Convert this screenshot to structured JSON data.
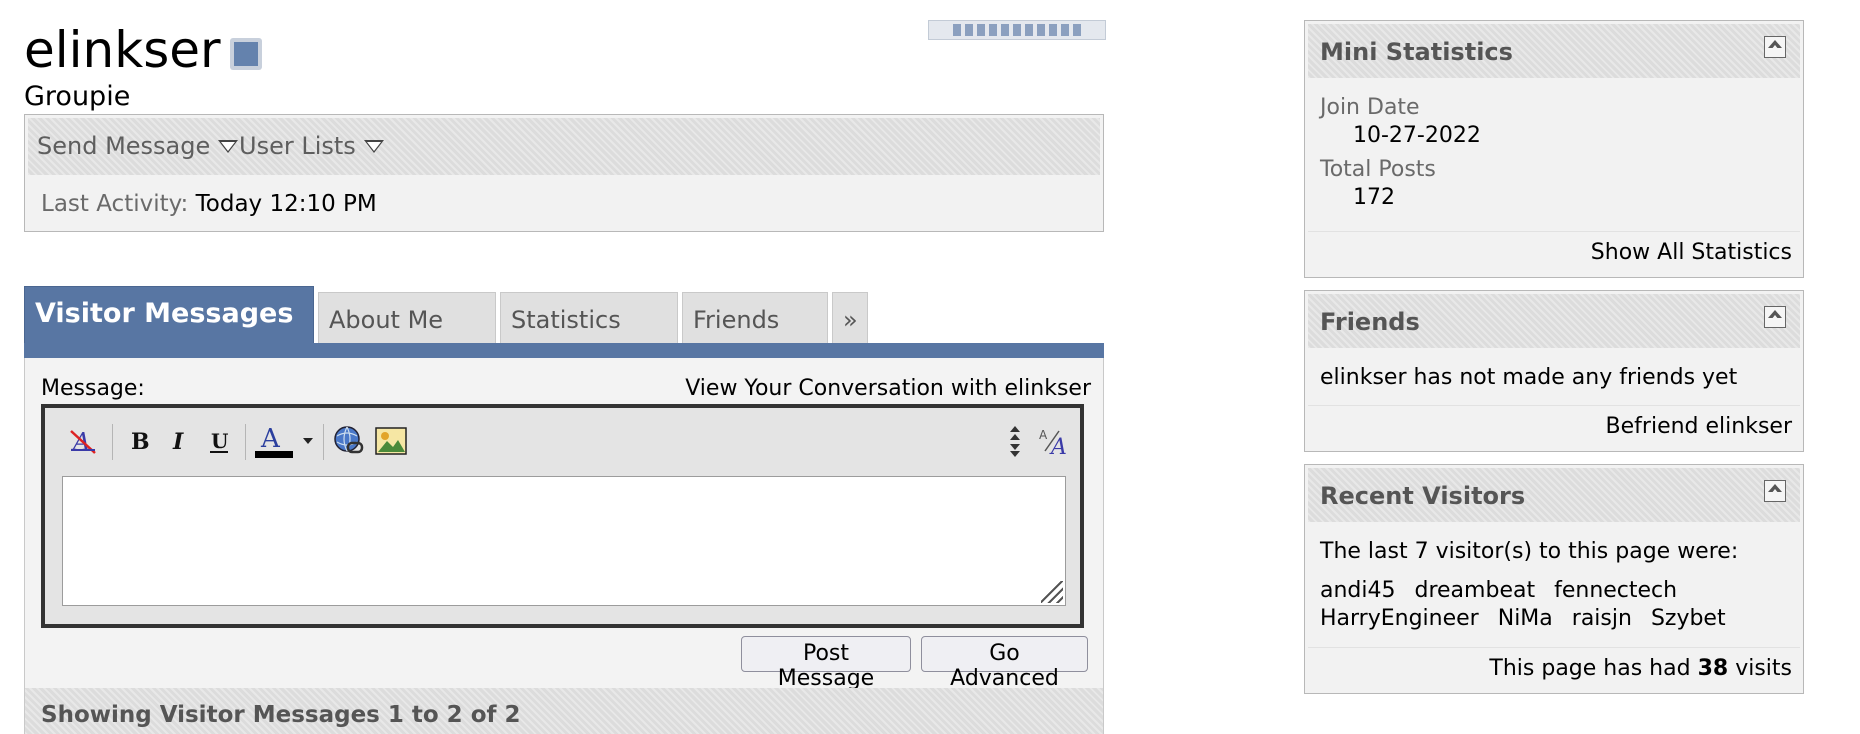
{
  "profile": {
    "username": "elinkser",
    "usertitle": "Groupie",
    "actions": {
      "send_message": "Send Message",
      "user_lists": "User Lists"
    },
    "last_activity_label": "Last Activity:",
    "last_activity_value": "Today 12:10 PM"
  },
  "tabs": [
    {
      "label": "Visitor Messages",
      "active": true
    },
    {
      "label": "About Me"
    },
    {
      "label": "Statistics"
    },
    {
      "label": "Friends"
    },
    {
      "label": "»"
    }
  ],
  "message_form": {
    "label": "Message:",
    "view_conversation": "View Your Conversation with elinkser",
    "textarea_value": "",
    "toolbar_icons": [
      "remove-format-icon",
      "bold-icon",
      "italic-icon",
      "underline-icon",
      "font-color-icon",
      "chevron-down-icon",
      "insert-link-icon",
      "insert-image-icon",
      "resize-arrows-icon",
      "switch-editor-mode-icon"
    ],
    "post_button": "Post Message",
    "advanced_button": "Go Advanced",
    "showing": "Showing Visitor Messages 1 to 2 of 2"
  },
  "sidebar": {
    "mini_statistics": {
      "title": "Mini Statistics",
      "join_date_label": "Join Date",
      "join_date": "10-27-2022",
      "total_posts_label": "Total Posts",
      "total_posts": "172",
      "footer_link": "Show All Statistics"
    },
    "friends": {
      "title": "Friends",
      "empty_text": "elinkser has not made any friends yet",
      "footer_link": "Befriend elinkser"
    },
    "recent_visitors": {
      "title": "Recent Visitors",
      "intro": "The last 7 visitor(s) to this page were:",
      "visitors": [
        "andi45",
        "dreambeat",
        "fennectech",
        "HarryEngineer",
        "NiMa",
        "raisjn",
        "Szybet"
      ],
      "visits_prefix": "This page has had",
      "visits_count": "38",
      "visits_suffix": "visits"
    }
  },
  "colors": {
    "tab_accent": "#5876a3",
    "panel_bg": "#f2f2f2"
  }
}
